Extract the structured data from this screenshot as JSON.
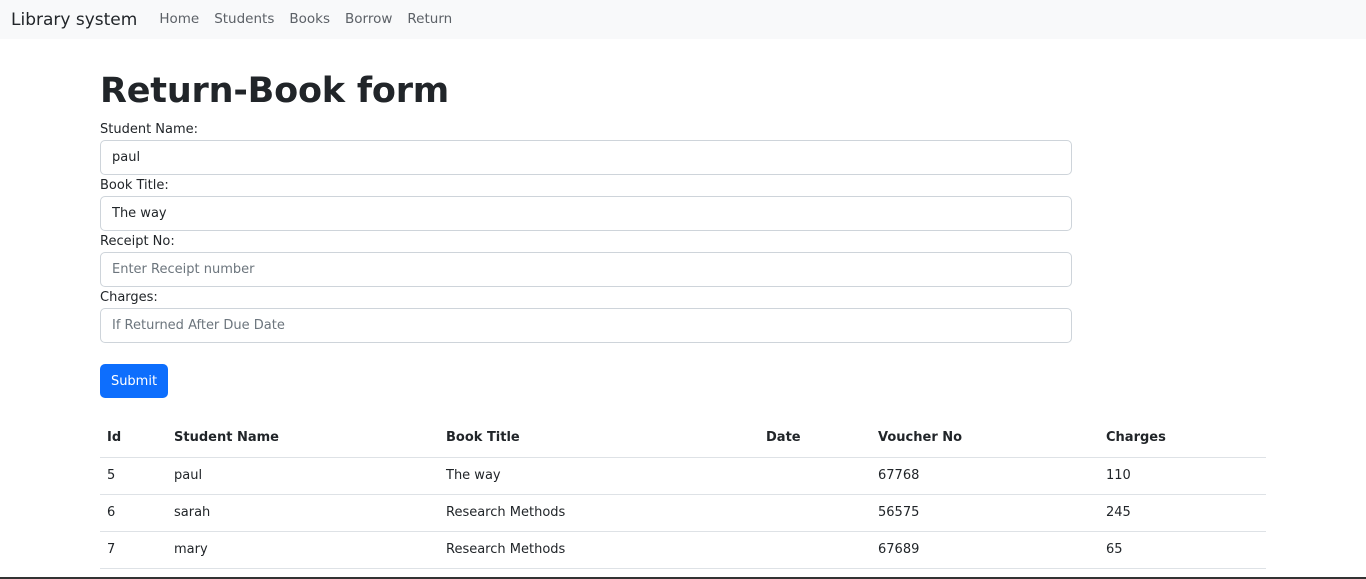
{
  "navbar": {
    "brand": "Library system",
    "links": [
      "Home",
      "Students",
      "Books",
      "Borrow",
      "Return"
    ]
  },
  "page_title": "Return-Book form",
  "form": {
    "student_name": {
      "label": "Student Name:",
      "value": "paul",
      "placeholder": ""
    },
    "book_title": {
      "label": "Book Title:",
      "value": "The way",
      "placeholder": ""
    },
    "receipt_no": {
      "label": "Receipt No:",
      "value": "",
      "placeholder": "Enter Receipt number"
    },
    "charges": {
      "label": "Charges:",
      "value": "",
      "placeholder": "If Returned After Due Date"
    },
    "submit_label": "Submit"
  },
  "table": {
    "headers": [
      "Id",
      "Student Name",
      "Book Title",
      "Date",
      "Voucher No",
      "Charges"
    ],
    "rows": [
      [
        "5",
        "paul",
        "The way",
        "",
        "67768",
        "110"
      ],
      [
        "6",
        "sarah",
        "Research Methods",
        "",
        "56575",
        "245"
      ],
      [
        "7",
        "mary",
        "Research Methods",
        "",
        "67689",
        "65"
      ]
    ]
  },
  "colors": {
    "accent": "#0d6efd",
    "navbar_bg": "#f8f9fa"
  }
}
